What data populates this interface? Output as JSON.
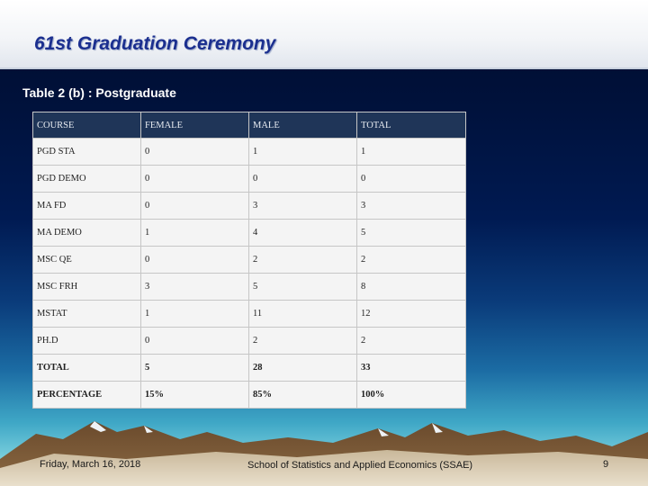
{
  "slide": {
    "title": "61st Graduation Ceremony",
    "subtitle": "Table 2 (b) : Postgraduate"
  },
  "table": {
    "headers": [
      "COURSE",
      "FEMALE",
      "MALE",
      "TOTAL"
    ],
    "rows": [
      [
        "PGD STA",
        "0",
        "1",
        "1"
      ],
      [
        "PGD DEMO",
        "0",
        "0",
        "0"
      ],
      [
        "MA  FD",
        "0",
        "3",
        "3"
      ],
      [
        "MA  DEMO",
        "1",
        "4",
        "5"
      ],
      [
        "MSC QE",
        "0",
        "2",
        "2"
      ],
      [
        "MSC FRH",
        "3",
        "5",
        "8"
      ],
      [
        "MSTAT",
        "1",
        "11",
        "12"
      ],
      [
        "PH.D",
        "0",
        "2",
        "2"
      ],
      [
        "TOTAL",
        "5",
        "28",
        "33"
      ],
      [
        "PERCENTAGE",
        "15%",
        "85%",
        "100%"
      ]
    ]
  },
  "footer": {
    "date": "Friday, March 16, 2018",
    "school": "School of Statistics and Applied Economics (SSAE)",
    "page": "9"
  }
}
